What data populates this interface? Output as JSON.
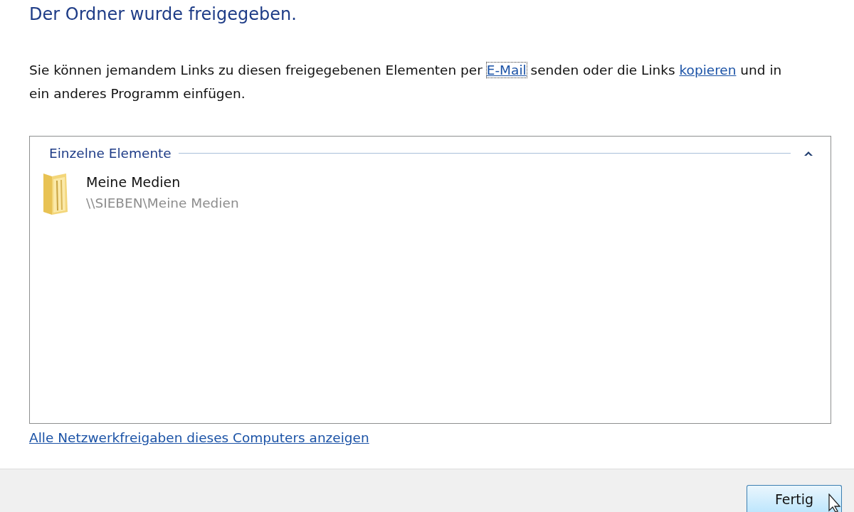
{
  "heading": "Der Ordner wurde freigegeben.",
  "description": [
    {
      "kind": "text",
      "text": "Sie können jemandem Links zu diesen freigegebenen Elementen per "
    },
    {
      "kind": "link",
      "text": "E-Mail",
      "focused": true
    },
    {
      "kind": "text",
      "text": " senden oder die Links "
    },
    {
      "kind": "link",
      "text": "kopieren",
      "focused": false
    },
    {
      "kind": "text",
      "text": " und in ein anderes Programm einfügen."
    }
  ],
  "group": {
    "title": "Einzelne Elemente",
    "expanded": true,
    "items": [
      {
        "name": "Meine Medien",
        "path": "\\\\SIEBEN\\Meine Medien"
      }
    ]
  },
  "network_link": "Alle Netzwerkfreigaben dieses Computers anzeigen",
  "buttons": [
    {
      "label": "Fertig",
      "hovered": true
    }
  ]
}
